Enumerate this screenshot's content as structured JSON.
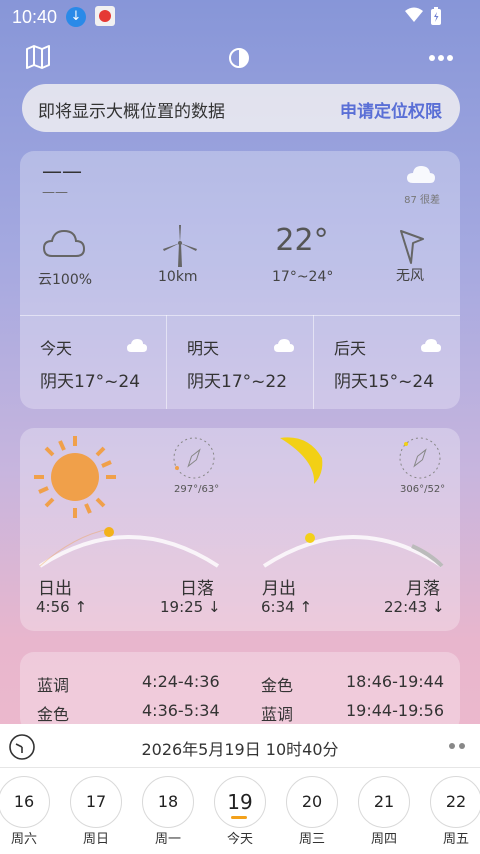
{
  "status": {
    "time": "10:40"
  },
  "banner": {
    "text": "即将显示大概位置的数据",
    "action": "申请定位权限"
  },
  "current": {
    "location": "——",
    "sub": "——",
    "aqi": "87 很差",
    "cloud": "云100%",
    "visibility": "10km",
    "temp": "22°",
    "range": "17°~24°",
    "wind": "无风"
  },
  "forecast": [
    {
      "name": "今天",
      "value": "阴天17°~24"
    },
    {
      "name": "明天",
      "value": "阴天17°~22"
    },
    {
      "name": "后天",
      "value": "阴天15°~24"
    }
  ],
  "sun": {
    "compass": "297°/63°",
    "rise_label": "日出",
    "set_label": "日落",
    "rise_time": "4:56 ↑",
    "set_time": "19:25 ↓",
    "sun_color": "#f0a04a"
  },
  "moon": {
    "compass": "306°/52°",
    "rise_label": "月出",
    "set_label": "月落",
    "rise_time": "6:34 ↑",
    "set_time": "22:43 ↓",
    "moon_color": "#f2d015"
  },
  "hours": [
    {
      "name": "蓝调",
      "time": "4:24-4:36"
    },
    {
      "name": "金色",
      "time": "4:36-5:34"
    },
    {
      "name": "金色",
      "time": "18:46-19:44"
    },
    {
      "name": "蓝调",
      "time": "19:44-19:56"
    }
  ],
  "datebar": {
    "text": "2026年5月19日  10时40分"
  },
  "week": [
    {
      "num": "16",
      "label": "周六"
    },
    {
      "num": "17",
      "label": "周日"
    },
    {
      "num": "18",
      "label": "周一"
    },
    {
      "num": "19",
      "label": "今天"
    },
    {
      "num": "20",
      "label": "周三"
    },
    {
      "num": "21",
      "label": "周四"
    },
    {
      "num": "22",
      "label": "周五"
    }
  ],
  "colors": {
    "accent": "#5a6fd6",
    "today_underline": "#f3a11b"
  }
}
